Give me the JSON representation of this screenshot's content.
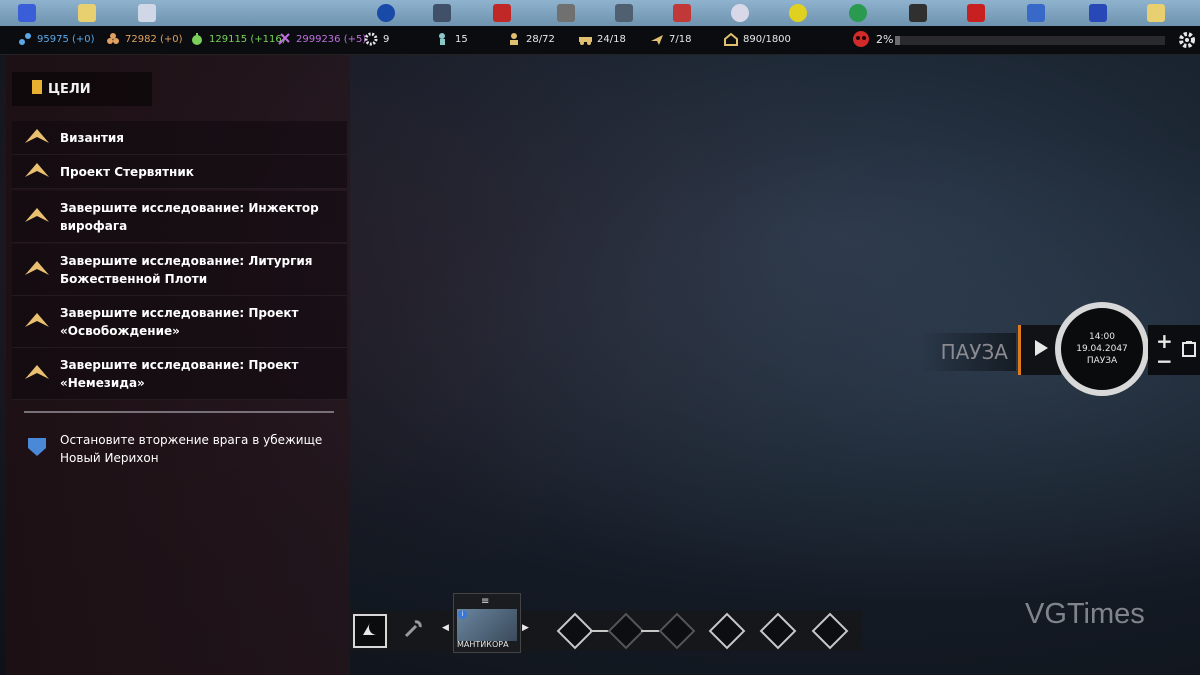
{
  "resources": [
    {
      "icon": "network-icon",
      "text": "95975 (+0)",
      "color": "#5aa8e8"
    },
    {
      "icon": "food-icon",
      "text": "72982 (+0)",
      "color": "#e0a060"
    },
    {
      "icon": "apple-icon",
      "text": "129115 (+116)",
      "color": "#7ad05a"
    },
    {
      "icon": "dna-icon",
      "text": "2999236 (+5)",
      "color": "#c070e0"
    },
    {
      "icon": "gear-icon",
      "text": "9",
      "color": "#e8e8e8"
    },
    {
      "icon": "scientist-icon",
      "text": "15",
      "color": "#e8e8e8"
    },
    {
      "icon": "soldier-icon",
      "text": "28/72",
      "color": "#e8e8e8"
    },
    {
      "icon": "vehicle-icon",
      "text": "24/18",
      "color": "#e8e8e8"
    },
    {
      "icon": "aircraft-icon",
      "text": "7/18",
      "color": "#e8e8e8"
    },
    {
      "icon": "storage-icon",
      "text": "890/1800",
      "color": "#e8e8e8"
    }
  ],
  "threat": {
    "icon": "skull-icon",
    "percent_text": "2%",
    "fill": 0.02
  },
  "objectives": {
    "title": "ЦЕЛИ",
    "items": [
      "Византия",
      "Проект Стервятник",
      "Завершите исследование: Инжектор вирофага",
      "Завершите исследование: Литургия Божественной Плоти",
      "Завершите исследование: Проект «Освобождение»",
      "Завершите исследование: Проект «Немезида»"
    ],
    "secondary": "Остановите вторжение врага в убежище Новый Иерихон"
  },
  "time": {
    "pause_label": "ПАУЗА",
    "time": "14:00",
    "date": "19.04.2047",
    "status": "ПАУЗА"
  },
  "bottom": {
    "aircraft_name": "МАНТИКОРА"
  },
  "watermark": "VGTimes",
  "colors": {
    "accent": "#e07a1a",
    "objective_icon": "#e8c070"
  }
}
